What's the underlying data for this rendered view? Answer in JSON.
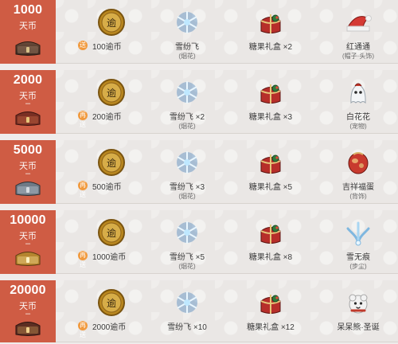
{
  "rows": [
    {
      "amount": "1000",
      "unit": "天币",
      "dash": "",
      "badge": "送",
      "coin_label": "100逾币",
      "snow_label": "雪纷飞",
      "snow_sub": "(烟花)",
      "candy_label": "糖果礼盒 ×2",
      "prize_label": "红通通",
      "prize_sub": "(帽子·头饰)",
      "prize_icon": "santa-hat-icon"
    },
    {
      "amount": "2000",
      "unit": "天币",
      "dash": "–",
      "badge": "再送",
      "coin_label": "200逾币",
      "snow_label": "雪纷飞 ×2",
      "snow_sub": "(烟花)",
      "candy_label": "糖果礼盒 ×3",
      "prize_label": "白花花",
      "prize_sub": "(宠物)",
      "prize_icon": "white-ghost-pet-icon"
    },
    {
      "amount": "5000",
      "unit": "天币",
      "dash": "–",
      "badge": "再送",
      "coin_label": "500逾币",
      "snow_label": "雪纷飞 ×3",
      "snow_sub": "(烟花)",
      "candy_label": "糖果礼盒 ×5",
      "prize_label": "吉祥福蛋",
      "prize_sub": "(背饰)",
      "prize_icon": "lucky-egg-icon"
    },
    {
      "amount": "10000",
      "unit": "天币",
      "dash": "–",
      "badge": "再送",
      "coin_label": "1000逾币",
      "snow_label": "雪纷飞 ×5",
      "snow_sub": "(烟花)",
      "candy_label": "糖果礼盒 ×8",
      "prize_label": "雪无痕",
      "prize_sub": "(步尘)",
      "prize_icon": "snow-trace-icon"
    },
    {
      "amount": "20000",
      "unit": "天币",
      "dash": "–",
      "badge": "再送",
      "coin_label": "2000逾币",
      "snow_label": "雪纷飞 ×10",
      "snow_sub": "",
      "candy_label": "糖果礼盒 ×12",
      "prize_label": "呆呆熊·圣诞",
      "prize_sub": "",
      "prize_icon": "xmas-bear-icon"
    }
  ],
  "colors": {
    "tier_bg": "#cf5c44",
    "badge_bg": "#f19a3e",
    "coin_gold": "#c99a2a"
  }
}
